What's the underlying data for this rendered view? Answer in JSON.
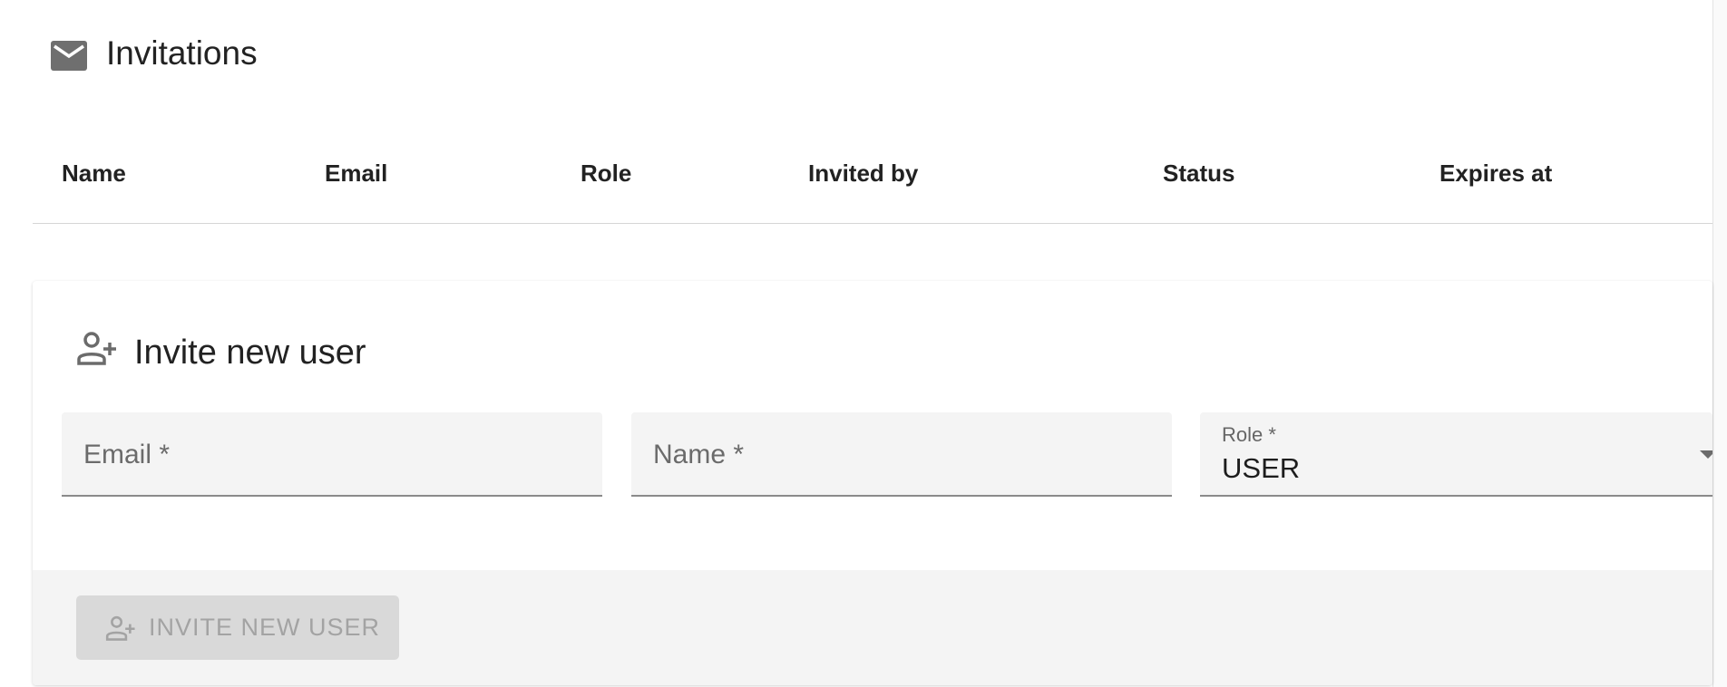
{
  "header": {
    "title": "Invitations",
    "icon": "mail-icon"
  },
  "table": {
    "columns": [
      "Name",
      "Email",
      "Role",
      "Invited by",
      "Status",
      "Expires at"
    ],
    "rows": []
  },
  "invite_card": {
    "title": "Invite new user",
    "icon": "person-add-icon",
    "email_field": {
      "label": "Email *",
      "value": ""
    },
    "name_field": {
      "label": "Name *",
      "value": ""
    },
    "role_field": {
      "label": "Role *",
      "value": "USER"
    },
    "submit_label": "INVITE NEW USER",
    "submit_disabled": true
  }
}
